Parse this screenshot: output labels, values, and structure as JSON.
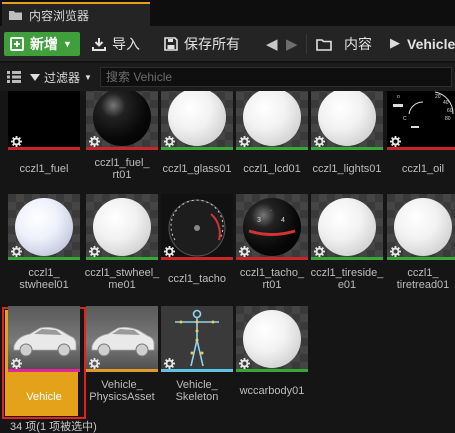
{
  "window": {
    "tab_title": "内容浏览器"
  },
  "toolbar": {
    "new_label": "新增",
    "import_label": "导入",
    "save_all_label": "保存所有",
    "breadcrumb": [
      "内容",
      "Vehicle"
    ]
  },
  "filterbar": {
    "filters_label": "过滤器",
    "search_placeholder": "搜索 Vehicle"
  },
  "assets": [
    {
      "label": "cczl1_fuel",
      "thumb": "black",
      "bar_color": "#c8262a"
    },
    {
      "label": "cczl1_fuel_\nrt01",
      "thumb": "sphere-black",
      "bar_color": "#c8262a"
    },
    {
      "label": "cczl1_glass01",
      "thumb": "sphere-white",
      "bar_color": "#35a835"
    },
    {
      "label": "cczl1_lcd01",
      "thumb": "sphere-white",
      "bar_color": "#35a835"
    },
    {
      "label": "cczl1_lights01",
      "thumb": "sphere-white",
      "bar_color": "#35a835"
    },
    {
      "label": "cczl1_oil",
      "thumb": "gauge-texture",
      "bar_color": "#c8262a"
    },
    {
      "label": "cczl1_\nstwheel01",
      "thumb": "sphere-lightblue",
      "bar_color": "#35a835"
    },
    {
      "label": "cczl1_stwheel_\nme01",
      "thumb": "sphere-white",
      "bar_color": "#35a835"
    },
    {
      "label": "cczl1_tacho",
      "thumb": "tacho-texture",
      "bar_color": "#c8262a"
    },
    {
      "label": "cczl1_tacho_\nrt01",
      "thumb": "sphere-tacho",
      "bar_color": "#c8262a"
    },
    {
      "label": "cczl1_tireside_\ne01",
      "thumb": "sphere-white",
      "bar_color": "#35a835"
    },
    {
      "label": "cczl1_\ntiretread01",
      "thumb": "sphere-white",
      "bar_color": "#35a835"
    },
    {
      "label": "Vehicle",
      "thumb": "car",
      "bar_color": "#e0279a",
      "selected": true
    },
    {
      "label": "Vehicle_\nPhysicsAsset",
      "thumb": "car",
      "bar_color": "#e09a2a"
    },
    {
      "label": "Vehicle_\nSkeleton",
      "thumb": "skeleton",
      "bar_color": "#5fc3e4"
    },
    {
      "label": "wccarbody01",
      "thumb": "sphere-white",
      "bar_color": "#35a835"
    }
  ],
  "status": {
    "text": "34 项(1 项被选中)"
  },
  "colors": {
    "accent_orange": "#e3a21a",
    "new_button_green": "#3f9f3b",
    "selection_outline": "#e0231c"
  }
}
